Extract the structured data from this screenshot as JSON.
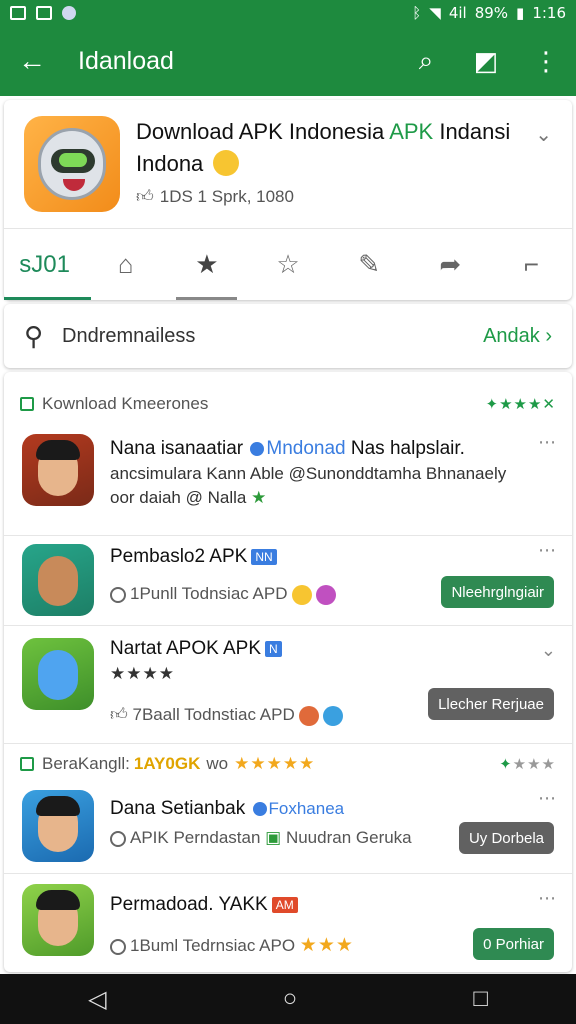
{
  "status": {
    "time": "1:16",
    "battery": "89%",
    "signal": "4il"
  },
  "appbar": {
    "title": "Idanload"
  },
  "app": {
    "name_prefix": "Download APK Indonesia ",
    "name_highlight": "APK",
    "name_suffix": " Indansi Indona",
    "meta": "1DS 1 Sprk, 1080"
  },
  "tabs": {
    "first_label": "sJ01"
  },
  "search": {
    "query": "Dndremnailess",
    "link": "Andak"
  },
  "sections": [
    {
      "title": "Kownload Kmeerones"
    },
    {
      "title": "BeraKangll:",
      "extra": "1AY0GK",
      "extra2": "wo"
    }
  ],
  "items": [
    {
      "title": "Nana isanaatiar",
      "tag": "Mndonad",
      "tag2": "Nas halpslair.",
      "line2": "ancsimulara Kann Able @Sunonddtamha Bhnanaely",
      "line3": "oor daiah @ Nalla"
    },
    {
      "title": "Pembaslo2 APK",
      "badge": "NN",
      "meta": "1Punll Todnsiac APD",
      "button": "Nleehrglngiair"
    },
    {
      "title": "Nartat APOK APK",
      "badge": "N",
      "meta": "7Baall Todnstiac APD",
      "button": "Llecher Rerjuae"
    },
    {
      "title": "Dana Setianbak",
      "tag": "Foxhanea",
      "meta": "APIK Perndastan",
      "meta2": "Nuudran Geruka",
      "button": "Uy Dorbela"
    },
    {
      "title": "Permadoad. YAKK",
      "badge": "AM",
      "meta": "1Buml Tedrnsiac APO",
      "button": "0 Porhiar"
    }
  ]
}
